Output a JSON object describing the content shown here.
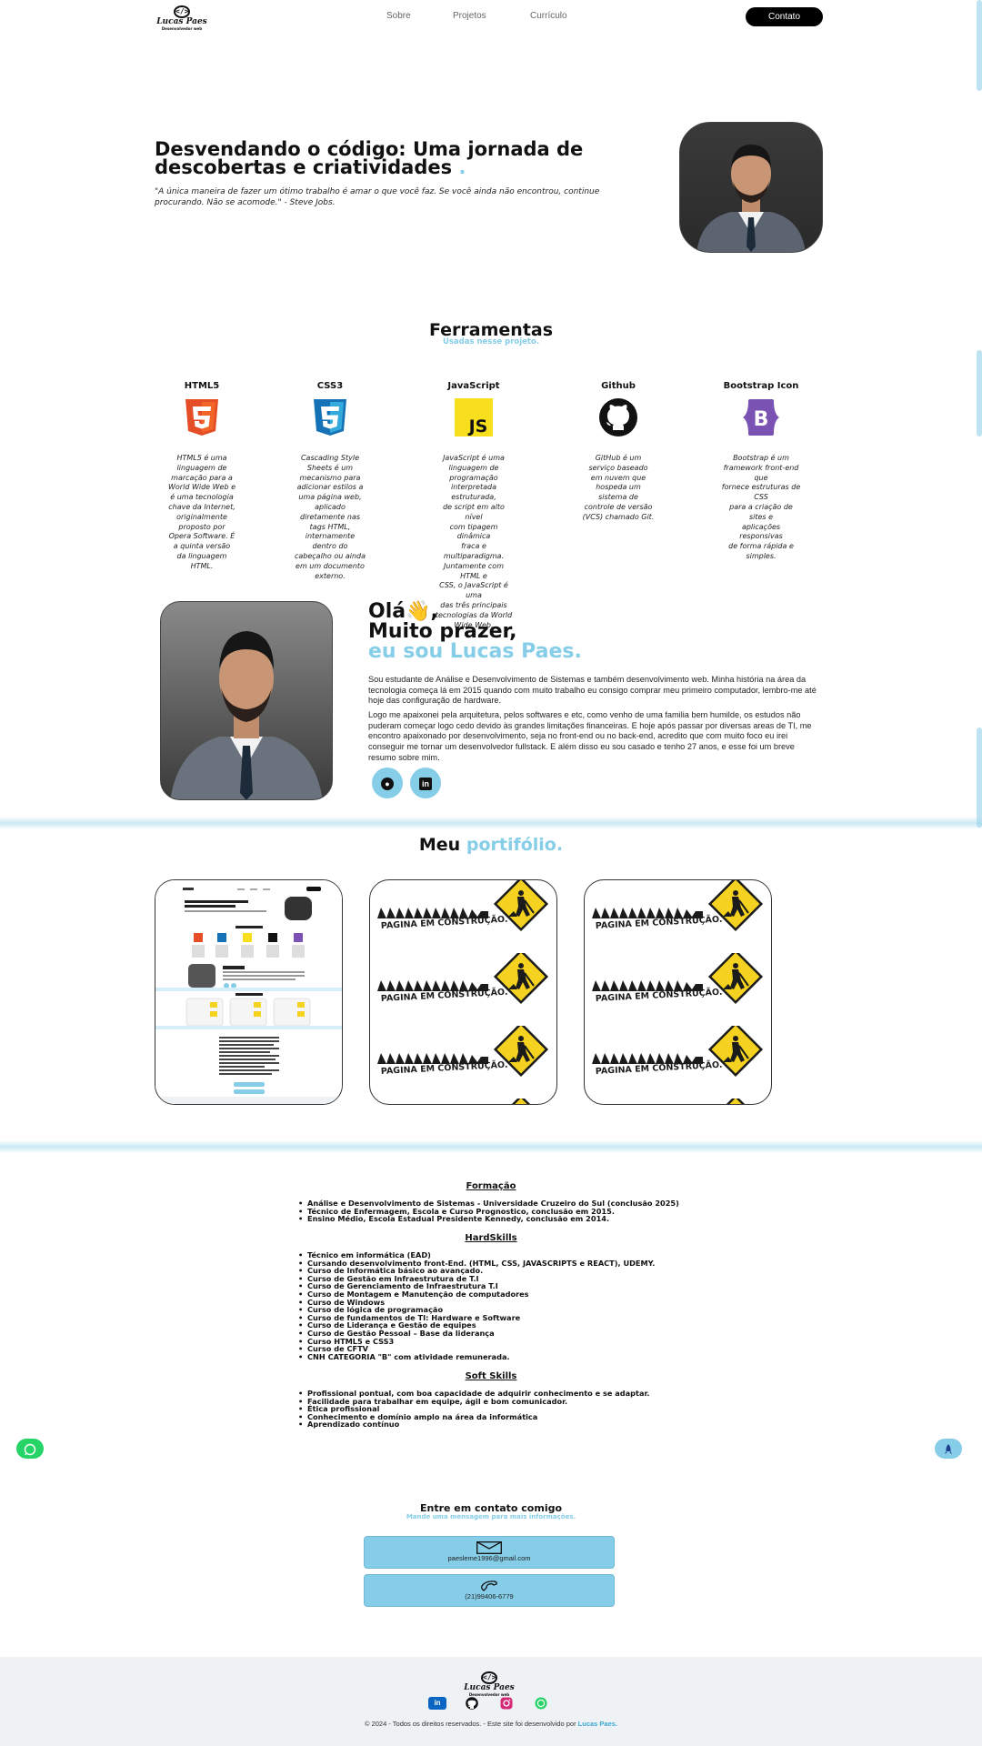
{
  "header": {
    "logo_name": "Lucas Paes",
    "logo_subtitle": "Desenvolvedor web",
    "nav": [
      "Sobre",
      "Projetos",
      "Currículo"
    ],
    "cta": "Contato"
  },
  "hero": {
    "title_line1": "Desvendando o código: Uma jornada de",
    "title_line2": "descobertas e criatividades",
    "title_dot": ".",
    "quote_line1": "\"A única maneira de fazer um ótimo trabalho é amar o que você faz. Se você ainda não encontrou, continue",
    "quote_line2": "procurando. Não se acomode.\" - Steve Jobs."
  },
  "tools": {
    "title": "Ferramentas",
    "subtitle": "Usadas nesse projeto.",
    "items": [
      {
        "name": "HTML5",
        "icon": "html5-icon",
        "desc": [
          "HTML5 é uma",
          "linguagem de",
          "marcação para a",
          "World Wide Web e",
          "é uma tecnologia",
          "chave da Internet,",
          "originalmente",
          "proposto por",
          "Opera Software. É",
          "a quinta versão",
          "da linguagem",
          "HTML."
        ]
      },
      {
        "name": "CSS3",
        "icon": "css3-icon",
        "desc": [
          "Cascading Style",
          "Sheets é um",
          "mecanismo para",
          "adicionar estilos a",
          "uma página web,",
          "aplicado",
          "diretamente nas",
          "tags HTML,",
          "internamente",
          "dentro do",
          "cabeçalho ou ainda",
          "em um documento",
          "externo."
        ]
      },
      {
        "name": "JavaScript",
        "icon": "javascript-icon",
        "desc": [
          "JavaScript é uma",
          "linguagem de",
          "programação",
          "interpretada estruturada,",
          "de script em alto nível",
          "com tipagem dinâmica",
          "fraca e multiparadigma.",
          "Juntamente com HTML e",
          "CSS, o JavaScript é uma",
          "das três principais",
          "tecnologias da World",
          "Wide Web."
        ]
      },
      {
        "name": "Github",
        "icon": "github-icon",
        "desc": [
          "GitHub é um",
          "serviço baseado",
          "em nuvem que",
          "hospeda um",
          "sistema de",
          "controle de versão",
          "(VCS) chamado Git."
        ]
      },
      {
        "name": "Bootstrap Icon",
        "icon": "bootstrap-icon",
        "desc": [
          "Bootstrap é um",
          "framework front-end que",
          "fornece estruturas de CSS",
          "para a criação de sites e",
          "aplicações responsivas",
          "de forma rápida e",
          "simples."
        ]
      }
    ]
  },
  "about": {
    "hello": "Olá",
    "wave_emoji": "👋",
    "comma": ",",
    "line2": "Muito prazer,",
    "line3": "eu sou Lucas Paes.",
    "p1": "Sou estudante de Análise e Desenvolvimento de Sistemas e também desenvolvimento web. Minha história na área da tecnologia começa lá em 2015 quando com muito trabalho eu consigo comprar meu primeiro computador, lembro-me até hoje das configuração de hardware.",
    "p2": "Logo me apaixonei pela arquitetura, pelos softwares e etc, como venho de uma familia bem humilde, os estudos não puderam começar logo cedo devido às grandes limitações financeiras. E hoje após passar por diversas areas de TI, me encontro apaixonado por desenvolvimento, seja no front-end ou no back-end, acredito que com muito foco eu irei conseguir me tornar um desenvolvedor fullstack. E além disso eu sou casado e tenho 27 anos, e esse foi um breve resumo sobre mim."
  },
  "portfolio": {
    "title": "Meu",
    "title_accent": "portifólio.",
    "construction_text": "PAGINA EM CONSTRUÇÃO."
  },
  "resume": {
    "formacao_title": "Formação",
    "formacao": [
      "Análise e Desenvolvimento de Sistemas - Universidade Cruzeiro do Sul (conclusão 2025)",
      "Técnico de Enfermagem, Escola e Curso Prognostico, conclusão em 2015.",
      "Ensino Médio, Escola Estadual Presidente Kennedy, conclusão em 2014."
    ],
    "hard_title": "HardSkills",
    "hard": [
      "Técnico em informática (EAD)",
      "Cursando desenvolvimento front-End. (HTML, CSS, JAVASCRIPTS e REACT), UDEMY.",
      "Curso de Informática básico ao avançado.",
      "Curso de Gestão em Infraestrutura de T.I",
      "Curso de Gerenciamento de Infraestrutura T.I",
      "Curso de Montagem e Manutenção de computadores",
      "Curso de Windows",
      "Curso de lógica de programação",
      "Curso de fundamentos de TI: Hardware e Software",
      "Curso de Liderança e Gestão de equipes",
      "Curso de Gestão Pessoal – Base da liderança",
      "Curso HTML5 e CSS3",
      "Curso de CFTV",
      "CNH CATEGORIA \"B\" com atividade remunerada."
    ],
    "soft_title": "Soft Skills",
    "soft": [
      "Profissional pontual, com boa capacidade de adquirir conhecimento e se adaptar.",
      "Facilidade para trabalhar em equipe, ágil e bom comunicador.",
      "Ética profissional",
      "Conhecimento e domínio amplo na área da informática",
      "Aprendizado contínuo"
    ]
  },
  "contact": {
    "title": "Entre em contato comigo",
    "subtitle": "Mande uma mensagem para mais informações.",
    "email": "paesleme1996@gmail.com",
    "phone": "(21)99406-6779"
  },
  "footer": {
    "copyright": "© 2024 - Todos os direitos reservados. - Este site foi desenvolvido por",
    "author": "Lucas Paes."
  },
  "colors": {
    "accent": "#86cde8",
    "dark": "#111111",
    "footer_bg": "#eef2f5"
  }
}
